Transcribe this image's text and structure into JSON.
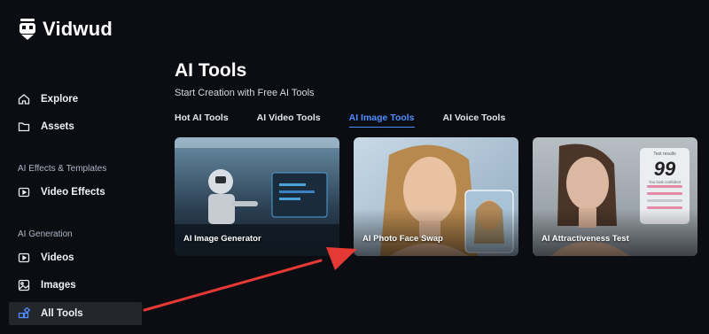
{
  "brand": {
    "name": "Vidwud"
  },
  "sidebar": {
    "top_items": [
      {
        "label": "Explore",
        "icon": "home-icon"
      },
      {
        "label": "Assets",
        "icon": "folder-icon"
      }
    ],
    "sections": [
      {
        "title": "AI Effects & Templates",
        "items": [
          {
            "label": "Video Effects",
            "icon": "video-play-icon"
          }
        ]
      },
      {
        "title": "AI Generation",
        "items": [
          {
            "label": "Videos",
            "icon": "video-play-icon"
          },
          {
            "label": "Images",
            "icon": "image-icon"
          },
          {
            "label": "All Tools",
            "icon": "grid-tools-icon",
            "active": true
          }
        ]
      }
    ]
  },
  "main": {
    "title": "AI Tools",
    "subtitle": "Start Creation with Free AI Tools",
    "tabs": [
      {
        "label": "Hot AI Tools",
        "active": false
      },
      {
        "label": "AI Video Tools",
        "active": false
      },
      {
        "label": "AI Image Tools",
        "active": true
      },
      {
        "label": "AI Voice Tools",
        "active": false
      }
    ],
    "cards": [
      {
        "label": "AI Image Generator"
      },
      {
        "label": "AI Photo Face Swap"
      },
      {
        "label": "AI Attractiveness Test",
        "result_title": "Test results",
        "score": "99",
        "caption": "You look confident"
      }
    ]
  },
  "colors": {
    "accent": "#4f8cff",
    "arrow": "#e53935",
    "active_bg": "#23262d",
    "background": "#0b0d12"
  }
}
